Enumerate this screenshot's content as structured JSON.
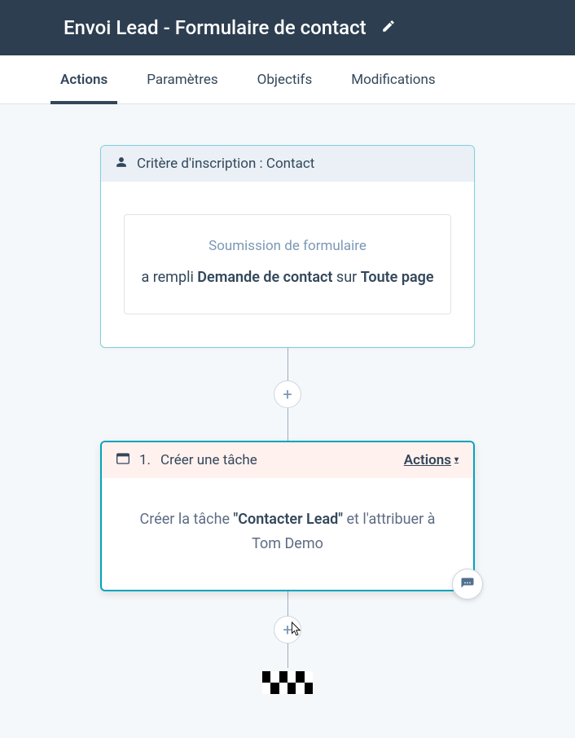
{
  "header": {
    "title": "Envoi Lead - Formulaire de contact"
  },
  "tabs": {
    "actions": "Actions",
    "parametres": "Paramètres",
    "objectifs": "Objectifs",
    "modifications": "Modifications"
  },
  "enrollment_card": {
    "title": "Critère d'inscription : Contact",
    "form_label": "Soumission de formulaire",
    "text_prefix": "a rempli ",
    "form_name": "Demande de contact",
    "text_mid": " sur ",
    "page": "Toute page"
  },
  "task_card": {
    "number": "1.",
    "title": "Créer une tâche",
    "actions_label": "Actions",
    "body_prefix": "Créer la tâche ",
    "task_name": "\"Contacter Lead\"",
    "body_mid": " et l'attribuer à ",
    "assignee": "Tom Demo"
  },
  "icons": {
    "plus": "+"
  }
}
